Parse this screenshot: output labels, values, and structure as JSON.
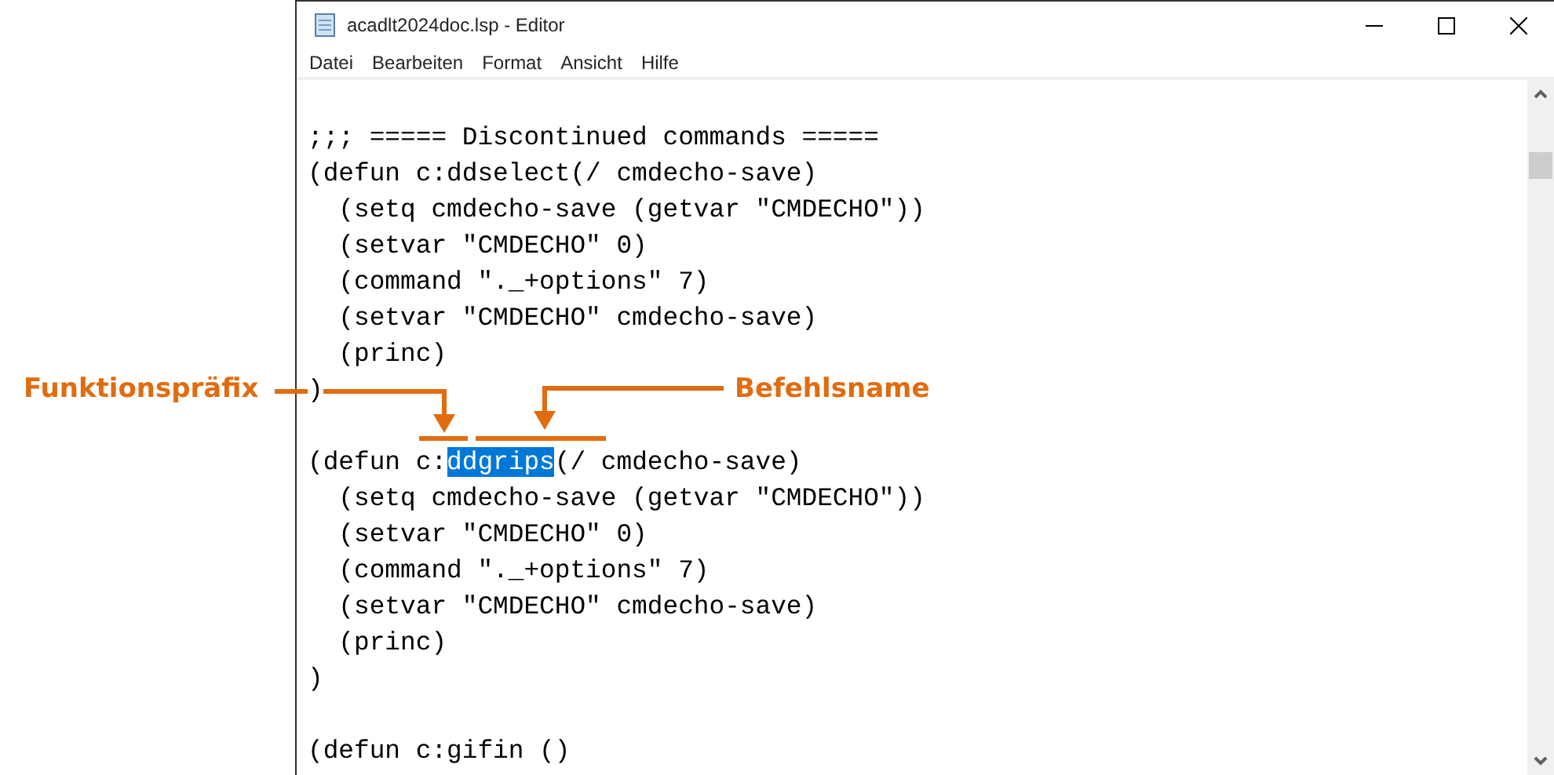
{
  "window": {
    "title": "acadlt2024doc.lsp - Editor"
  },
  "menu": [
    "Datei",
    "Bearbeiten",
    "Format",
    "Ansicht",
    "Hilfe"
  ],
  "lines": [
    {
      "text": ";;; ===== Discontinued commands =====",
      "blank_line_before": true
    },
    {
      "text": "(defun c:ddselect(/ cmdecho-save)"
    },
    {
      "text": "  (setq cmdecho-save (getvar \"CMDECHO\"))"
    },
    {
      "text": "  (setvar \"CMDECHO\" 0)"
    },
    {
      "text": "  (command \"._+options\" 7)"
    },
    {
      "text": "  (setvar \"CMDECHO\" cmdecho-save)"
    },
    {
      "text": "  (princ)"
    },
    {
      "text": ")"
    },
    {
      "text_before": "(defun c:",
      "selection": "ddgrips",
      "text_after": "(/ cmdecho-save)",
      "blank_line_before": true
    },
    {
      "text": "  (setq cmdecho-save (getvar \"CMDECHO\"))"
    },
    {
      "text": "  (setvar \"CMDECHO\" 0)"
    },
    {
      "text": "  (command \"._+options\" 7)"
    },
    {
      "text": "  (setvar \"CMDECHO\" cmdecho-save)"
    },
    {
      "text": "  (princ)"
    },
    {
      "text": ")"
    },
    {
      "text": "(defun c:gifin ()",
      "blank_line_before": true
    }
  ],
  "annotations": [
    {
      "label": "Funktionspräfix"
    },
    {
      "label": "Befehlsname"
    }
  ]
}
